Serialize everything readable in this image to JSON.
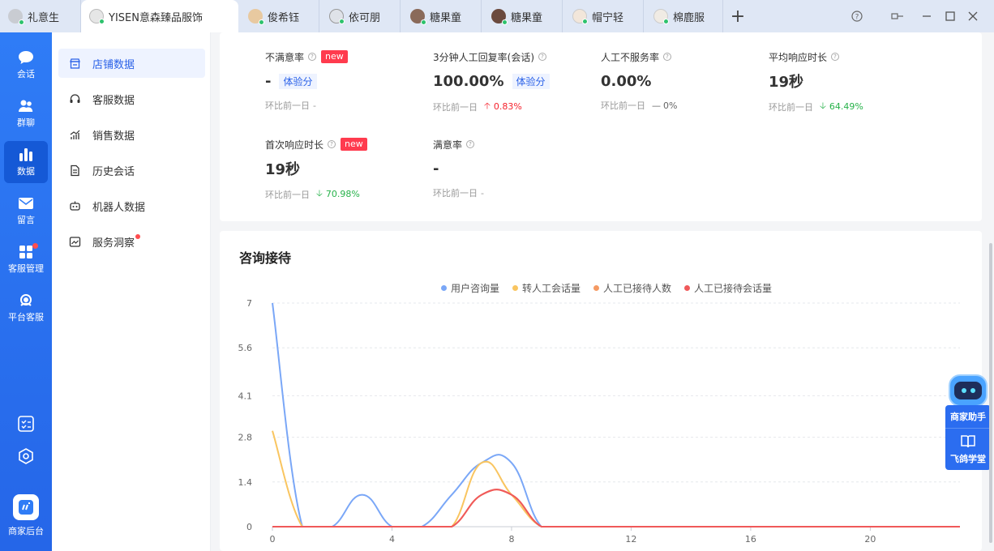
{
  "tabs": [
    {
      "label": "礼意生",
      "active": false
    },
    {
      "label": "YISEN意森臻品服饰",
      "active": true
    },
    {
      "label": "俊希钰",
      "active": false
    },
    {
      "label": "依可朋",
      "active": false
    },
    {
      "label": "糖果童",
      "active": false
    },
    {
      "label": "糖果童",
      "active": false
    },
    {
      "label": "帽宁轻",
      "active": false
    },
    {
      "label": "棉鹿服",
      "active": false
    }
  ],
  "tabbar_icons": [
    "plus-icon",
    "help-icon",
    "pin-icon",
    "minimize-icon",
    "maximize-icon",
    "close-icon"
  ],
  "leftnav": {
    "items": [
      {
        "label": "会话",
        "icon": "chat-icon"
      },
      {
        "label": "群聊",
        "icon": "group-icon"
      },
      {
        "label": "数据",
        "icon": "bar-chart-icon",
        "active": true
      },
      {
        "label": "留言",
        "icon": "mail-icon"
      },
      {
        "label": "客服管理",
        "icon": "apps-icon",
        "badge": true
      },
      {
        "label": "平台客服",
        "icon": "headset-icon"
      }
    ],
    "bottom": {
      "label": "商家后台"
    }
  },
  "subnav": {
    "items": [
      {
        "label": "店铺数据",
        "icon": "shop-icon",
        "active": true
      },
      {
        "label": "客服数据",
        "icon": "headset-icon"
      },
      {
        "label": "销售数据",
        "icon": "trend-icon"
      },
      {
        "label": "历史会话",
        "icon": "document-icon"
      },
      {
        "label": "机器人数据",
        "icon": "robot-icon"
      },
      {
        "label": "服务洞察",
        "icon": "insight-icon",
        "badge": true
      }
    ]
  },
  "metrics": {
    "compare_label": "环比前一日",
    "trial_tag": "体验分",
    "new_tag": "new",
    "items": [
      {
        "title": "不满意率",
        "new": true,
        "value": "-",
        "trial": true,
        "change": "-",
        "trend": "none"
      },
      {
        "title": "3分钟人工回复率(会话)",
        "new": false,
        "value": "100.00%",
        "trial": true,
        "change": "0.83%",
        "trend": "up"
      },
      {
        "title": "人工不服务率",
        "new": false,
        "value": "0.00%",
        "trial": false,
        "change": "0%",
        "trend": "flat"
      },
      {
        "title": "平均响应时长",
        "new": false,
        "value": "19秒",
        "trial": false,
        "change": "64.49%",
        "trend": "down"
      },
      {
        "title": "首次响应时长",
        "new": true,
        "value": "19秒",
        "trial": false,
        "change": "70.98%",
        "trend": "down"
      },
      {
        "title": "满意率",
        "new": false,
        "value": "-",
        "trial": false,
        "change": "-",
        "trend": "none"
      }
    ]
  },
  "consult": {
    "title": "咨询接待"
  },
  "assistant": {
    "label1": "商家助手",
    "label2": "飞鸽学堂"
  },
  "chart_data": {
    "type": "line",
    "title": "",
    "x": [
      0,
      1,
      2,
      3,
      4,
      5,
      6,
      7,
      8,
      9,
      10,
      11,
      12,
      13,
      14,
      15,
      16,
      17,
      18,
      19,
      20,
      21,
      22,
      23
    ],
    "xticks": [
      0,
      4,
      8,
      12,
      16,
      20
    ],
    "yticks": [
      0,
      1.4,
      2.8,
      4.1,
      5.6,
      7
    ],
    "ylim": [
      0,
      7
    ],
    "legend_position": "top",
    "series": [
      {
        "name": "用户咨询量",
        "color": "#7aa7f7",
        "values": [
          7,
          0,
          0,
          1,
          0,
          0,
          1,
          2,
          2,
          0,
          0,
          0,
          0,
          0,
          0,
          0,
          0,
          0,
          0,
          0,
          0,
          0,
          0,
          0
        ]
      },
      {
        "name": "转人工会话量",
        "color": "#f9c560",
        "values": [
          3,
          0,
          0,
          0,
          0,
          0,
          0,
          2,
          1,
          0,
          0,
          0,
          0,
          0,
          0,
          0,
          0,
          0,
          0,
          0,
          0,
          0,
          0,
          0
        ]
      },
      {
        "name": "人工已接待人数",
        "color": "#f59a63",
        "values": [
          0,
          0,
          0,
          0,
          0,
          0,
          0,
          1,
          1,
          0,
          0,
          0,
          0,
          0,
          0,
          0,
          0,
          0,
          0,
          0,
          0,
          0,
          0,
          0
        ]
      },
      {
        "name": "人工已接待会话量",
        "color": "#f0595a",
        "values": [
          0,
          0,
          0,
          0,
          0,
          0,
          0,
          1,
          1,
          0,
          0,
          0,
          0,
          0,
          0,
          0,
          0,
          0,
          0,
          0,
          0,
          0,
          0,
          0
        ]
      }
    ]
  }
}
